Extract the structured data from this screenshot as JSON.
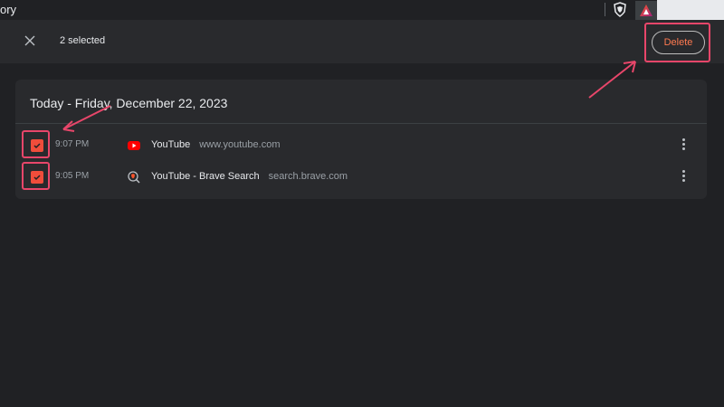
{
  "window": {
    "title_fragment": "ory"
  },
  "toolbar": {
    "selected_text": "2 selected",
    "delete_label": "Delete"
  },
  "history": {
    "date_heading": "Today - Friday, December 22, 2023",
    "entries": [
      {
        "time": "9:07 PM",
        "title": "YouTube",
        "domain": "www.youtube.com",
        "checked": true,
        "favicon": "youtube-icon"
      },
      {
        "time": "9:05 PM",
        "title": "YouTube - Brave Search",
        "domain": "search.brave.com",
        "checked": true,
        "favicon": "brave-search-icon"
      }
    ]
  },
  "colors": {
    "background": "#202124",
    "card": "#292a2d",
    "accent_checkbox": "#f04d3b",
    "delete_text": "#ff7a50",
    "annotation": "#e8466a"
  }
}
